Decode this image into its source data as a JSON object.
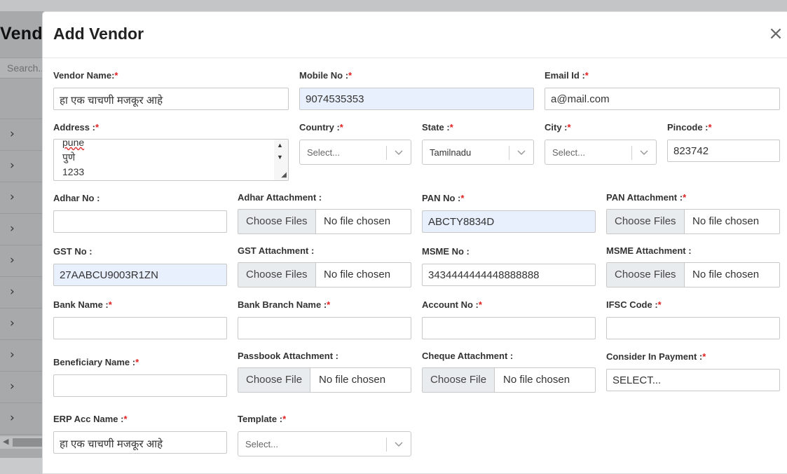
{
  "background": {
    "title": "Vend",
    "search_placeholder": "Search...",
    "row_chevron": "›"
  },
  "modal": {
    "title": "Add Vendor",
    "close": "×"
  },
  "fields": {
    "vendor_name": {
      "label": "Vendor Name:",
      "required": "*",
      "value": "हा एक चाचणी मजकूर आहे"
    },
    "mobile_no": {
      "label": "Mobile No :",
      "required": "*",
      "value": "9074535353"
    },
    "email_id": {
      "label": "Email Id :",
      "required": "*",
      "value": "a@mail.com"
    },
    "address": {
      "label": "Address :",
      "required": "*",
      "lines": [
        "pune",
        "पुणे",
        "1233"
      ]
    },
    "country": {
      "label": "Country :",
      "required": "*",
      "value": "Select..."
    },
    "state": {
      "label": "State :",
      "required": "*",
      "value": "Tamilnadu"
    },
    "city": {
      "label": "City :",
      "required": "*",
      "value": "Select..."
    },
    "pincode": {
      "label": "Pincode :",
      "required": "*",
      "value": "823742"
    },
    "adhar_no": {
      "label": "Adhar No :",
      "value": ""
    },
    "adhar_attachment": {
      "label": "Adhar Attachment :",
      "button": "Choose Files",
      "status": "No file chosen"
    },
    "pan_no": {
      "label": "PAN No :",
      "required": "*",
      "value": "ABCTY8834D"
    },
    "pan_attachment": {
      "label": "PAN Attachment :",
      "required": "*",
      "button": "Choose Files",
      "status": "No file chosen"
    },
    "gst_no": {
      "label": "GST No :",
      "value": "27AABCU9003R1ZN"
    },
    "gst_attachment": {
      "label": "GST Attachment :",
      "button": "Choose Files",
      "status": "No file chosen"
    },
    "msme_no": {
      "label": "MSME No :",
      "value": "3434444444448888888"
    },
    "msme_attachment": {
      "label": "MSME Attachment :",
      "button": "Choose Files",
      "status": "No file chosen"
    },
    "bank_name": {
      "label": "Bank Name :",
      "required": "*",
      "value": ""
    },
    "bank_branch_name": {
      "label": "Bank Branch Name :",
      "required": "*",
      "value": ""
    },
    "account_no": {
      "label": "Account No :",
      "required": "*",
      "value": ""
    },
    "ifsc_code": {
      "label": "IFSC Code :",
      "required": "*",
      "value": ""
    },
    "beneficiary_name": {
      "label": "Beneficiary Name :",
      "required": "*",
      "value": ""
    },
    "passbook_attachment": {
      "label": "Passbook Attachment :",
      "button": "Choose File",
      "status": "No file chosen"
    },
    "cheque_attachment": {
      "label": "Cheque Attachment :",
      "button": "Choose File",
      "status": "No file chosen"
    },
    "consider_in_payment": {
      "label": "Consider In Payment :",
      "required": "*",
      "value": "SELECT..."
    },
    "erp_acc_name": {
      "label": "ERP Acc Name :",
      "required": "*",
      "value": "हा एक चाचणी मजकूर आहे"
    },
    "template": {
      "label": "Template :",
      "required": "*",
      "value": "Select..."
    }
  },
  "colors": {
    "required": "#e02020",
    "autofill": "#e8effd"
  }
}
